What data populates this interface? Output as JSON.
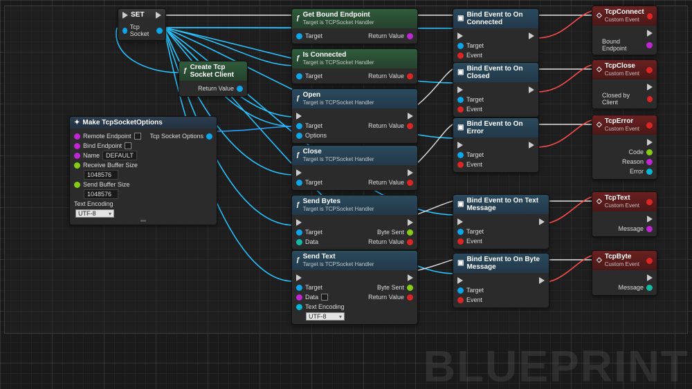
{
  "watermark": "BLUEPRINT",
  "encoding_options": "UTF-8",
  "nodes": {
    "set": {
      "title": "SET",
      "out": "Tcp Socket"
    },
    "create": {
      "title": "Create Tcp Socket Client",
      "ret": "Return Value"
    },
    "make": {
      "title": "Make TcpSocketOptions",
      "remote": "Remote Endpoint",
      "bind": "Bind Endpoint",
      "name": "Name",
      "name_val": "DEFAULT",
      "recv": "Receive Buffer Size",
      "recv_val": "1048576",
      "send": "Send Buffer Size",
      "send_val": "1048576",
      "enc": "Text Encoding",
      "out": "Tcp Socket Options"
    },
    "getbound": {
      "title": "Get Bound Endpoint",
      "sub": "Target is TCPSocket Handler",
      "target": "Target",
      "ret": "Return Value"
    },
    "isconn": {
      "title": "Is Connected",
      "sub": "Target is TCPSocket Handler",
      "target": "Target",
      "ret": "Return Value"
    },
    "open": {
      "title": "Open",
      "sub": "Target is TCPSocket Handler",
      "target": "Target",
      "options": "Options",
      "ret": "Return Value"
    },
    "close": {
      "title": "Close",
      "sub": "Target is TCPSocket Handler",
      "target": "Target",
      "ret": "Return Value"
    },
    "sendb": {
      "title": "Send Bytes",
      "sub": "Target is TCPSocket Handler",
      "target": "Target",
      "data": "Data",
      "bs": "Byte Sent",
      "ret": "Return Value"
    },
    "sendt": {
      "title": "Send Text",
      "sub": "Target is TCPSocket Handler",
      "target": "Target",
      "data": "Data",
      "enc": "Text Encoding",
      "bs": "Byte Sent",
      "ret": "Return Value"
    },
    "bconn": {
      "title": "Bind Event to On Connected",
      "target": "Target",
      "event": "Event"
    },
    "bclosed": {
      "title": "Bind Event to On Closed",
      "target": "Target",
      "event": "Event"
    },
    "berror": {
      "title": "Bind Event to On Error",
      "target": "Target",
      "event": "Event"
    },
    "btext": {
      "title": "Bind Event to On Text Message",
      "target": "Target",
      "event": "Event"
    },
    "bbyte": {
      "title": "Bind Event to On Byte Message",
      "target": "Target",
      "event": "Event"
    },
    "econn": {
      "title": "TcpConnect",
      "sub": "Custom Event",
      "p1": "Bound Endpoint"
    },
    "eclose": {
      "title": "TcpClose",
      "sub": "Custom Event",
      "p1": "Closed by Client"
    },
    "eerror": {
      "title": "TcpError",
      "sub": "Custom Event",
      "p1": "Code",
      "p2": "Reason",
      "p3": "Error"
    },
    "etext": {
      "title": "TcpText",
      "sub": "Custom Event",
      "p1": "Message"
    },
    "ebyte": {
      "title": "TcpByte",
      "sub": "Custom Event",
      "p1": "Message"
    }
  }
}
